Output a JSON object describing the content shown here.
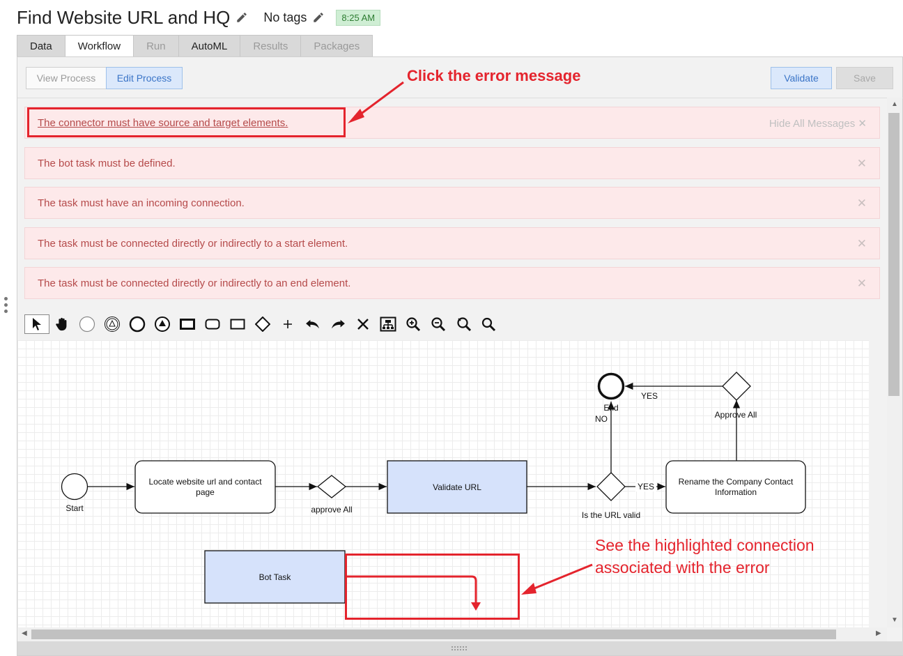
{
  "header": {
    "title": "Find Website URL and HQ",
    "tags": "No tags",
    "time": "8:25 AM"
  },
  "tabs": [
    {
      "label": "Data",
      "state": "normal"
    },
    {
      "label": "Workflow",
      "state": "active"
    },
    {
      "label": "Run",
      "state": "disabled"
    },
    {
      "label": "AutoML",
      "state": "normal"
    },
    {
      "label": "Results",
      "state": "disabled"
    },
    {
      "label": "Packages",
      "state": "disabled"
    }
  ],
  "actions": {
    "view_process": "View Process",
    "edit_process": "Edit Process",
    "validate": "Validate",
    "save": "Save"
  },
  "messages": {
    "hide_all": "Hide All Messages",
    "close_glyph": "✕",
    "items": [
      {
        "text": "The connector must have source and target elements.",
        "link": true
      },
      {
        "text": "The bot task must be defined.",
        "link": false
      },
      {
        "text": "The task must have an incoming connection.",
        "link": false
      },
      {
        "text": "The task must be connected directly or indirectly to a start element.",
        "link": false
      },
      {
        "text": "The task must be connected directly or indirectly to an end element.",
        "link": false
      }
    ]
  },
  "toolbar": {
    "icons": [
      "pointer-icon",
      "hand-icon",
      "start-event-icon",
      "signal-event-icon",
      "end-event-icon",
      "escalation-event-icon",
      "task-icon",
      "subprocess-icon",
      "rectangle-icon",
      "gateway-icon",
      "add-icon",
      "undo-icon",
      "redo-icon",
      "delete-icon",
      "fit-icon",
      "zoom-in-icon",
      "zoom-out-icon",
      "zoom-reset-icon",
      "search-icon"
    ]
  },
  "diagram": {
    "start": "Start",
    "task_locate": [
      "Locate website url and contact",
      "page"
    ],
    "gateway_approve": "approve All",
    "task_validate": "Validate URL",
    "gateway_valid": "Is the URL valid",
    "yes": "YES",
    "no": "NO",
    "task_rename": [
      "Rename the Company Contact",
      "Information"
    ],
    "gateway_approve2": "Approve All",
    "end": "End",
    "bot_task": "Bot Task"
  },
  "annotations": {
    "click_error": "Click the error message",
    "see_highlighted": "See the highlighted connection associated with the error",
    "color": "#e4242d"
  },
  "colors": {
    "error_bg": "#fde9ea",
    "error_text": "#b54a4a",
    "accent_blue": "#3a74c7",
    "task_fill": "#d6e2fb"
  }
}
